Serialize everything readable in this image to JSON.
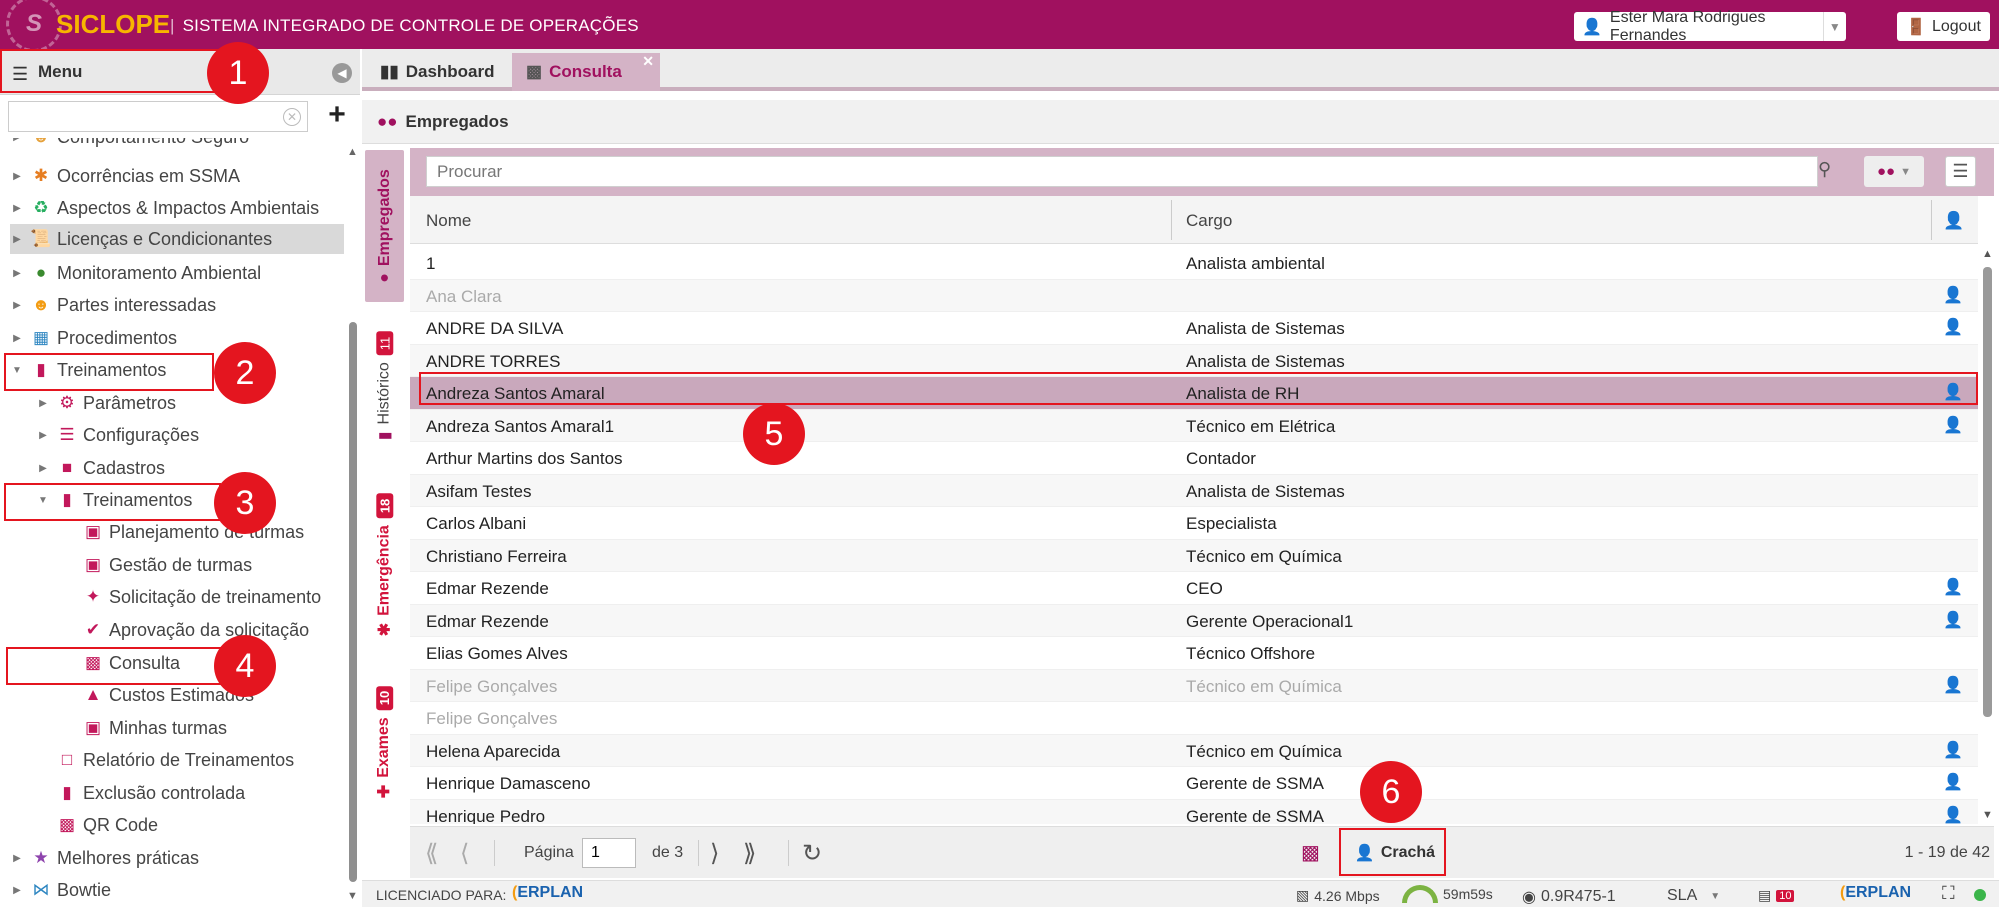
{
  "header": {
    "logo_name": "SICLOPE",
    "system_title": "SISTEMA INTEGRADO DE CONTROLE DE OPERAÇÕES",
    "user_name": "Ester Mara Rodrigues Fernandes",
    "logout_label": "Logout"
  },
  "menu": {
    "title": "Menu",
    "search_value": "",
    "items": [
      {
        "label": "Comportamento Seguro"
      },
      {
        "label": "Ocorrências em SSMA"
      },
      {
        "label": "Aspectos & Impactos Ambientais"
      },
      {
        "label": "Licenças e Condicionantes"
      },
      {
        "label": "Monitoramento Ambiental"
      },
      {
        "label": "Partes interessadas"
      },
      {
        "label": "Procedimentos"
      },
      {
        "label": "Treinamentos"
      },
      {
        "label": "Parâmetros"
      },
      {
        "label": "Configurações"
      },
      {
        "label": "Cadastros"
      },
      {
        "label": "Treinamentos"
      },
      {
        "label": "Planejamento de turmas"
      },
      {
        "label": "Gestão de turmas"
      },
      {
        "label": "Solicitação de treinamento"
      },
      {
        "label": "Aprovação da solicitação"
      },
      {
        "label": "Consulta"
      },
      {
        "label": "Custos Estimados"
      },
      {
        "label": "Minhas turmas"
      },
      {
        "label": "Relatório de Treinamentos"
      },
      {
        "label": "Exclusão controlada"
      },
      {
        "label": "QR Code"
      },
      {
        "label": "Melhores práticas"
      },
      {
        "label": "Bowtie"
      }
    ]
  },
  "tabs": [
    {
      "label": "Dashboard"
    },
    {
      "label": "Consulta"
    }
  ],
  "panel": {
    "title": "Empregados",
    "side_tabs": [
      {
        "label": "Empregados",
        "badge": ""
      },
      {
        "label": "Histórico",
        "badge": "11"
      },
      {
        "label": "Emergência",
        "badge": "18"
      },
      {
        "label": "Exames",
        "badge": "10"
      }
    ]
  },
  "grid": {
    "search_placeholder": "Procurar",
    "columns": [
      "Nome",
      "Cargo"
    ],
    "rows": [
      {
        "nome": "1",
        "cargo": "Analista ambiental",
        "badge": false,
        "inactive": false
      },
      {
        "nome": "Ana Clara",
        "cargo": "",
        "badge": true,
        "inactive": true
      },
      {
        "nome": "ANDRE DA SILVA",
        "cargo": "Analista de Sistemas",
        "badge": true,
        "inactive": false
      },
      {
        "nome": "ANDRE TORRES",
        "cargo": "Analista de Sistemas",
        "badge": false,
        "inactive": false
      },
      {
        "nome": "Andreza Santos Amaral",
        "cargo": "Analista de RH",
        "badge": true,
        "inactive": false,
        "selected": true
      },
      {
        "nome": "Andreza Santos Amaral1",
        "cargo": "Técnico em Elétrica",
        "badge": true,
        "inactive": false
      },
      {
        "nome": "Arthur Martins dos Santos",
        "cargo": "Contador",
        "badge": false,
        "inactive": false
      },
      {
        "nome": "Asifam Testes",
        "cargo": "Analista de Sistemas",
        "badge": false,
        "inactive": false
      },
      {
        "nome": "Carlos Albani",
        "cargo": "Especialista",
        "badge": false,
        "inactive": false
      },
      {
        "nome": "Christiano Ferreira",
        "cargo": "Técnico em Química",
        "badge": false,
        "inactive": false
      },
      {
        "nome": "Edmar Rezende",
        "cargo": "CEO",
        "badge": true,
        "inactive": false
      },
      {
        "nome": "Edmar Rezende",
        "cargo": "Gerente Operacional1",
        "badge": true,
        "inactive": false
      },
      {
        "nome": "Elias Gomes Alves",
        "cargo": "Técnico Offshore",
        "badge": false,
        "inactive": false
      },
      {
        "nome": "Felipe Gonçalves",
        "cargo": "Técnico em Química",
        "badge": true,
        "inactive": true
      },
      {
        "nome": "Felipe Gonçalves",
        "cargo": "",
        "badge": false,
        "inactive": true
      },
      {
        "nome": "Helena Aparecida",
        "cargo": "Técnico em Química",
        "badge": true,
        "inactive": false
      },
      {
        "nome": "Henrique Damasceno",
        "cargo": "Gerente de SSMA",
        "badge": true,
        "inactive": false
      },
      {
        "nome": "Henrique Pedro",
        "cargo": "Gerente de SSMA",
        "badge": true,
        "inactive": false
      }
    ]
  },
  "pager": {
    "page_label": "Página",
    "page_value": "1",
    "of_label": "de 3",
    "cracha_label": "Crachá",
    "info": "1 - 19 de 42"
  },
  "status": {
    "licensed_label": "LICENCIADO PARA:",
    "brand_left": "ERPLAN",
    "speed": "4.26 Mbps",
    "timer": "59m59s",
    "version": "0.9R475-1",
    "sla_label": "SLA",
    "notif_count": "10",
    "brand_right": "ERPLAN"
  },
  "annotations": [
    "1",
    "2",
    "3",
    "4",
    "5",
    "6"
  ],
  "colors": {
    "brand": "#a0115f",
    "logo_accent": "#f7b500",
    "selection": "#c9a8bc",
    "highlight": "#e4151f",
    "badge_red": "#d2143c"
  }
}
